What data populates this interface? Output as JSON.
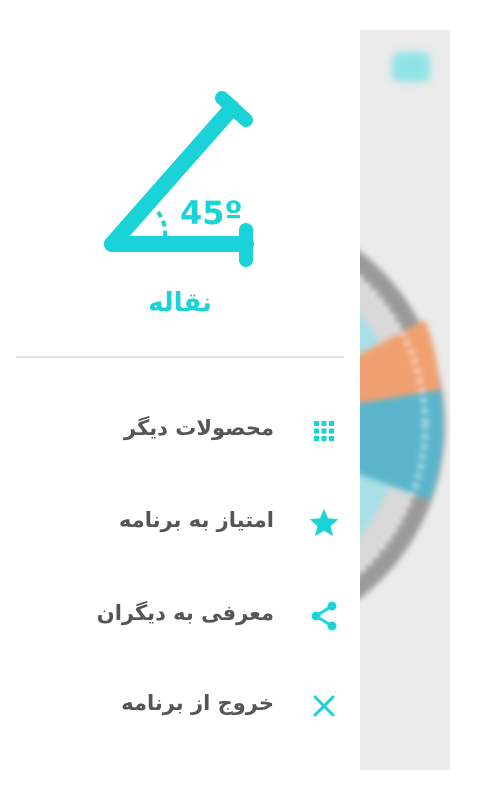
{
  "theme": {
    "accent": "#19d3d8",
    "label_color": "#555555",
    "divider_color": "#e3e3e3"
  },
  "drawer": {
    "logo": {
      "icon": "protractor-angle-icon",
      "angle_text": "45º"
    },
    "app_name": "نقاله",
    "menu": [
      {
        "label": "محصولات دیگر",
        "icon": "grid-icon"
      },
      {
        "label": "امتیاز به برنامه",
        "icon": "star-icon"
      },
      {
        "label": "معرفی به دیگران",
        "icon": "share-icon"
      },
      {
        "label": "خروج از برنامه",
        "icon": "close-icon"
      }
    ]
  }
}
